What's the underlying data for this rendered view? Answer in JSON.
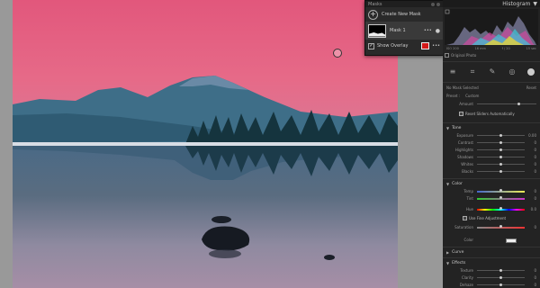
{
  "masks_panel": {
    "header": "Masks",
    "create_label": "Create New Mask",
    "mask_name": "Mask 1",
    "mask_more": "•••",
    "overlay_label": "Show Overlay",
    "overlay_checked": true,
    "overlay_color": "#d21919",
    "overlay_more": "•••"
  },
  "panel": {
    "title": "Histogram",
    "hist_stats": [
      "ISO 200",
      "16 mm",
      "f / 20",
      "15 sec"
    ],
    "original_photo": "Original Photo",
    "tool_icons": [
      "sliders-icon",
      "crop-icon",
      "healing-icon",
      "redeye-icon",
      "masking-icon"
    ],
    "no_mask": "No Mask Selected",
    "reset": "Reset",
    "preset_label": "Preset :",
    "preset_value": "Custom",
    "amount_label": "Amount",
    "reset_sliders": "Reset Sliders Automatically",
    "tone": {
      "title": "Tone",
      "sliders": [
        {
          "name": "Exposure",
          "value": "0.00"
        },
        {
          "name": "Contrast",
          "value": "0"
        },
        {
          "name": "Highlights",
          "value": "0"
        },
        {
          "name": "Shadows",
          "value": "0"
        },
        {
          "name": "Whites",
          "value": "0"
        },
        {
          "name": "Blacks",
          "value": "0"
        }
      ]
    },
    "color": {
      "title": "Color",
      "temp": {
        "name": "Temp",
        "value": "0"
      },
      "tint": {
        "name": "Tint",
        "value": "0"
      },
      "hue": {
        "name": "Hue",
        "value": "0.0"
      },
      "fine": "Use Fine Adjustment",
      "saturation": {
        "name": "Saturation",
        "value": "0"
      },
      "color_label": "Color"
    },
    "curve_title": "Curve",
    "effects": {
      "title": "Effects",
      "sliders": [
        {
          "name": "Texture",
          "value": "0"
        },
        {
          "name": "Clarity",
          "value": "0"
        },
        {
          "name": "Dehaze",
          "value": "0"
        }
      ]
    }
  }
}
